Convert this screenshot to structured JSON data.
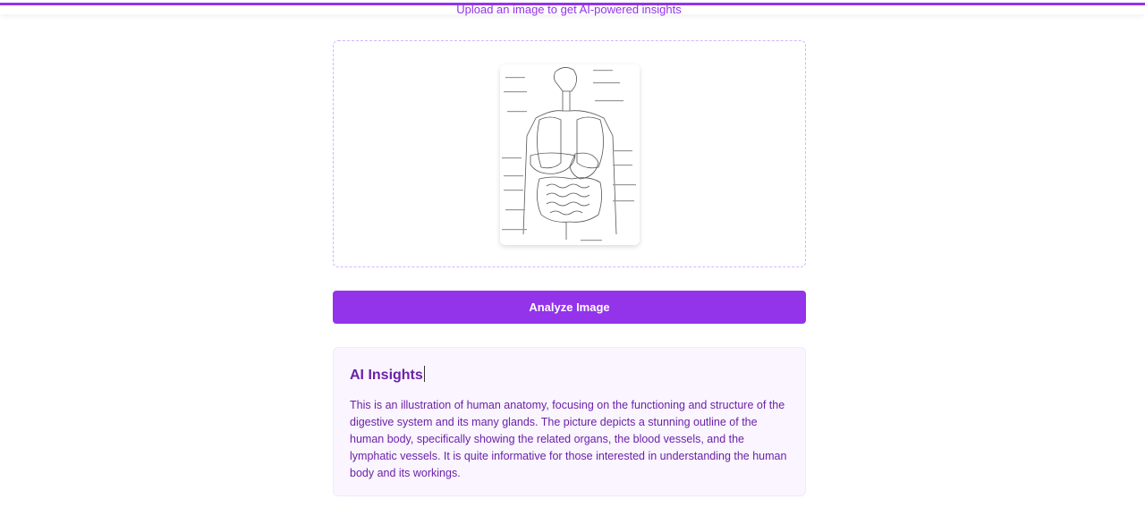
{
  "header": {
    "subtitle": "Upload an image to get AI-powered insights",
    "accent_color": "#9333ea"
  },
  "upload": {
    "preview_icon": "anatomy-illustration"
  },
  "actions": {
    "analyze_label": "Analyze Image"
  },
  "insights": {
    "title": "AI Insights",
    "body": "This is an illustration of human anatomy, focusing on the functioning and structure of the digestive system and its many glands. The picture depicts a stunning outline of the human body, specifically showing the related organs, the blood vessels, and the lymphatic vessels. It is quite informative for those interested in understanding the human body and its workings."
  }
}
